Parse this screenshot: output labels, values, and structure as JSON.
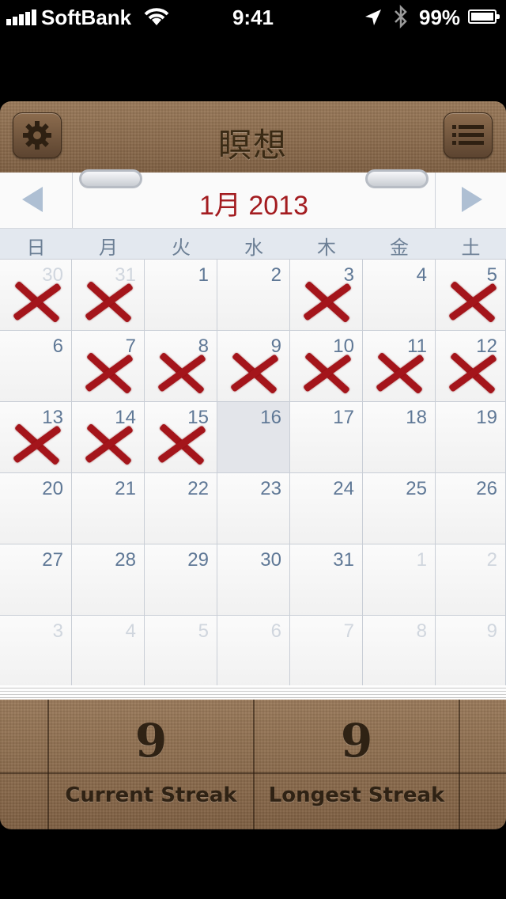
{
  "status_bar": {
    "carrier": "SoftBank",
    "time": "9:41",
    "battery": "99%",
    "icons": [
      "signal-icon",
      "wifi-icon",
      "location-icon",
      "bluetooth-icon",
      "battery-icon"
    ]
  },
  "header": {
    "title": "瞑想",
    "left_button": "settings-gear-icon",
    "right_button": "list-menu-icon"
  },
  "calendar": {
    "month_title": "1月 2013",
    "prev_icon": "left-triangle-icon",
    "next_icon": "right-triangle-icon",
    "weekdays": [
      "日",
      "月",
      "火",
      "水",
      "木",
      "金",
      "土"
    ],
    "weeks": [
      [
        {
          "d": "30",
          "other": true,
          "x": true
        },
        {
          "d": "31",
          "other": true,
          "x": true
        },
        {
          "d": "1"
        },
        {
          "d": "2"
        },
        {
          "d": "3",
          "x": true
        },
        {
          "d": "4"
        },
        {
          "d": "5",
          "x": true
        }
      ],
      [
        {
          "d": "6"
        },
        {
          "d": "7",
          "x": true
        },
        {
          "d": "8",
          "x": true
        },
        {
          "d": "9",
          "x": true
        },
        {
          "d": "10",
          "x": true
        },
        {
          "d": "11",
          "x": true
        },
        {
          "d": "12",
          "x": true
        }
      ],
      [
        {
          "d": "13",
          "x": true
        },
        {
          "d": "14",
          "x": true
        },
        {
          "d": "15",
          "x": true
        },
        {
          "d": "16",
          "today": true
        },
        {
          "d": "17"
        },
        {
          "d": "18"
        },
        {
          "d": "19"
        }
      ],
      [
        {
          "d": "20"
        },
        {
          "d": "21"
        },
        {
          "d": "22"
        },
        {
          "d": "23"
        },
        {
          "d": "24"
        },
        {
          "d": "25"
        },
        {
          "d": "26"
        }
      ],
      [
        {
          "d": "27"
        },
        {
          "d": "28"
        },
        {
          "d": "29"
        },
        {
          "d": "30"
        },
        {
          "d": "31"
        },
        {
          "d": "1",
          "other": true
        },
        {
          "d": "2",
          "other": true
        }
      ],
      [
        {
          "d": "3",
          "other": true
        },
        {
          "d": "4",
          "other": true
        },
        {
          "d": "5",
          "other": true
        },
        {
          "d": "6",
          "other": true
        },
        {
          "d": "7",
          "other": true
        },
        {
          "d": "8",
          "other": true
        },
        {
          "d": "9",
          "other": true
        }
      ]
    ],
    "colors": {
      "mark": "#a4151b",
      "month_title": "#a31c20",
      "day_number": "#5f7896"
    }
  },
  "streaks": {
    "current_value": "9",
    "current_label": "Current Streak",
    "longest_value": "9",
    "longest_label": "Longest Streak"
  }
}
